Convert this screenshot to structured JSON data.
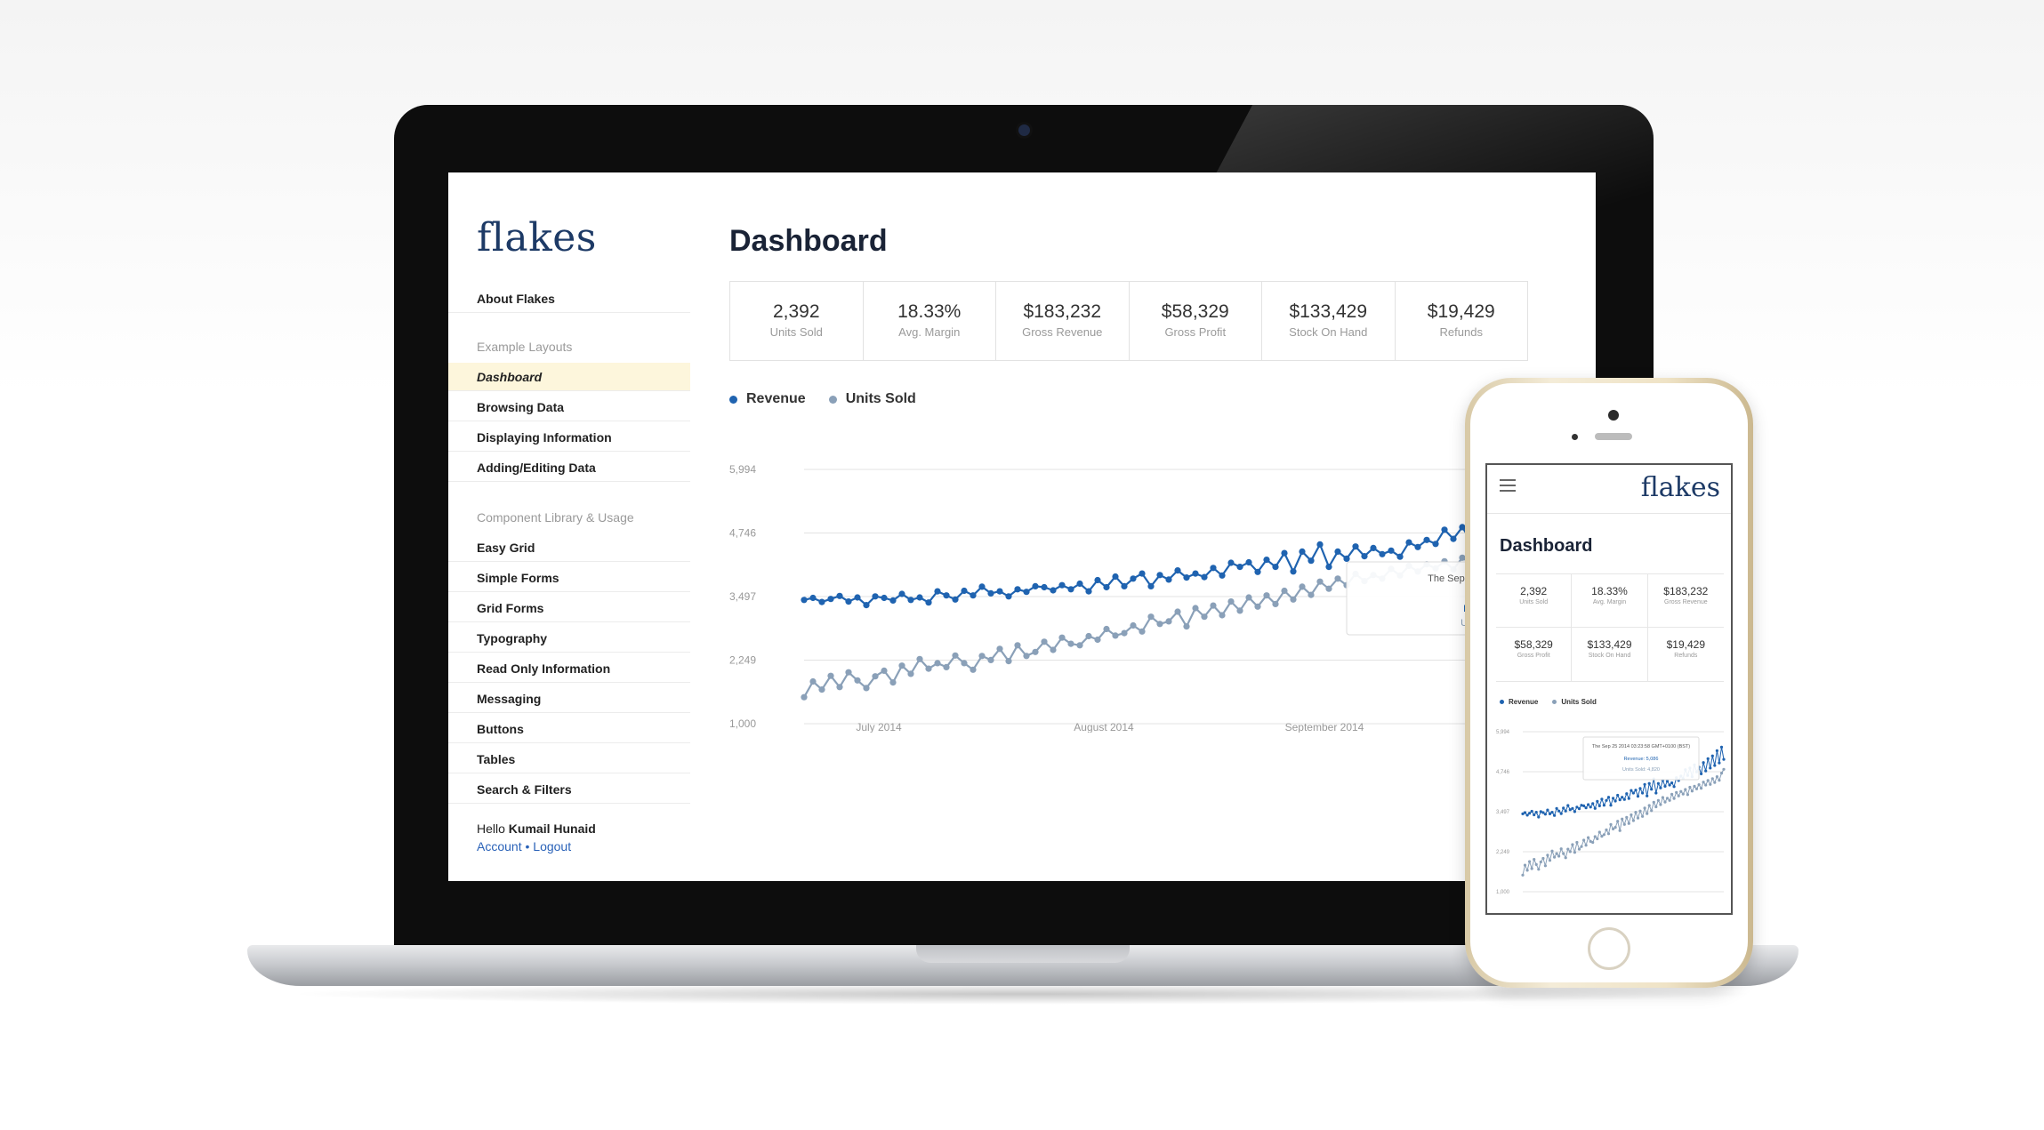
{
  "app": {
    "logo": "flakes",
    "page_title": "Dashboard"
  },
  "sidebar": {
    "about": "About Flakes",
    "section_layouts": "Example Layouts",
    "layouts": [
      "Dashboard",
      "Browsing Data",
      "Displaying Information",
      "Adding/Editing Data"
    ],
    "active_layout": "Dashboard",
    "section_components": "Component Library & Usage",
    "components": [
      "Easy Grid",
      "Simple Forms",
      "Grid Forms",
      "Typography",
      "Read Only Information",
      "Messaging",
      "Buttons",
      "Tables",
      "Search & Filters"
    ],
    "greeting_prefix": "Hello",
    "user_name": "Kumail Hunaid",
    "account_link": "Account",
    "separator": "•",
    "logout_link": "Logout"
  },
  "stats": [
    {
      "value": "2,392",
      "label": "Units Sold"
    },
    {
      "value": "18.33%",
      "label": "Avg. Margin"
    },
    {
      "value": "$183,232",
      "label": "Gross Revenue"
    },
    {
      "value": "$58,329",
      "label": "Gross Profit"
    },
    {
      "value": "$133,429",
      "label": "Stock On Hand"
    },
    {
      "value": "$19,429",
      "label": "Refunds"
    }
  ],
  "tooltip": {
    "date_line1": "The Sep 25 2014 03:23:58 GMT",
    "date_line2": "(BST)",
    "revenue": "Revenue: 5,086",
    "units": "Units Sold: 4,820"
  },
  "colors": {
    "revenue": "#1f63b0",
    "units": "#8aa0b8",
    "brand": "#1d3a66",
    "active_bg": "#fdf6dc"
  },
  "chart_data": {
    "type": "line",
    "legend": [
      "Revenue",
      "Units Sold"
    ],
    "y_ticks": [
      "5,994",
      "4,746",
      "3,497",
      "2,249",
      "1,000"
    ],
    "x_ticks": [
      "July 2014",
      "August 2014",
      "September 2014"
    ],
    "ylim": [
      1000,
      5994
    ],
    "x_count": 90,
    "series": [
      {
        "name": "Revenue",
        "values": [
          3430,
          3470,
          3390,
          3450,
          3510,
          3400,
          3480,
          3330,
          3500,
          3470,
          3420,
          3550,
          3430,
          3480,
          3380,
          3600,
          3520,
          3440,
          3610,
          3520,
          3690,
          3560,
          3600,
          3500,
          3640,
          3590,
          3700,
          3680,
          3620,
          3720,
          3640,
          3750,
          3600,
          3820,
          3680,
          3890,
          3700,
          3850,
          3950,
          3700,
          3920,
          3830,
          4010,
          3870,
          3950,
          3880,
          4060,
          3910,
          4160,
          4080,
          4170,
          3980,
          4220,
          4080,
          4350,
          3990,
          4380,
          4200,
          4520,
          4080,
          4380,
          4240,
          4480,
          4290,
          4450,
          4330,
          4400,
          4280,
          4560,
          4470,
          4610,
          4530,
          4810,
          4630,
          4860,
          4590,
          4960,
          4740,
          4890,
          4680,
          5030,
          4770,
          5150,
          4860,
          5240,
          4940,
          5400,
          5020,
          5510,
          5130
        ]
      },
      {
        "name": "Units Sold",
        "values": [
          1520,
          1830,
          1670,
          1940,
          1720,
          2010,
          1850,
          1700,
          1930,
          2040,
          1810,
          2140,
          1980,
          2270,
          2080,
          2190,
          2110,
          2340,
          2190,
          2060,
          2330,
          2250,
          2470,
          2230,
          2540,
          2330,
          2410,
          2610,
          2450,
          2690,
          2570,
          2540,
          2720,
          2650,
          2860,
          2730,
          2780,
          2930,
          2810,
          3100,
          2960,
          3010,
          3200,
          2910,
          3270,
          3100,
          3320,
          3130,
          3400,
          3220,
          3480,
          3300,
          3520,
          3350,
          3610,
          3440,
          3690,
          3530,
          3790,
          3650,
          3850,
          3720,
          3940,
          3800,
          3920,
          3850,
          4040,
          3910,
          4100,
          3990,
          4130,
          4050,
          4190,
          4030,
          4260,
          4140,
          4290,
          4210,
          4340,
          4230,
          4420,
          4330,
          4470,
          4350,
          4530,
          4410,
          4590,
          4480,
          4700,
          4820
        ]
      }
    ]
  },
  "phone": {
    "logo": "flakes",
    "page_title": "Dashboard",
    "y_ticks": [
      "5,994",
      "4,746",
      "3,497",
      "2,249",
      "1,000"
    ],
    "tooltip_line1": "The Sep 25 2014 03:23:58 GMT+0100 (BST)",
    "tooltip_revenue": "Revenue: 5,086",
    "tooltip_units": "Units Sold: 4,820"
  }
}
